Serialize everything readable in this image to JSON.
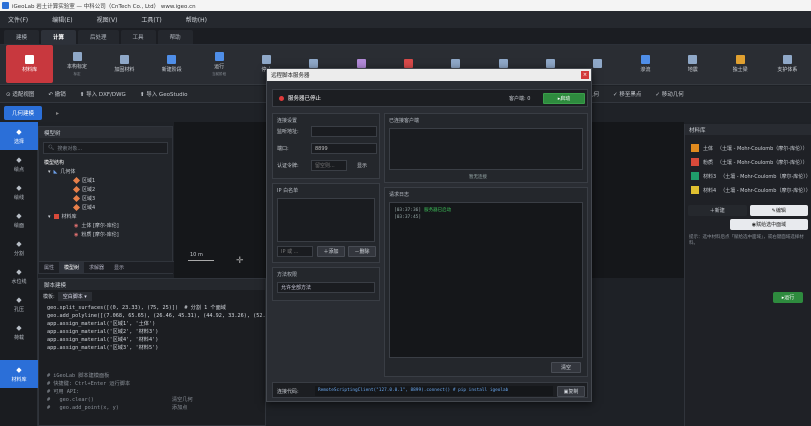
{
  "app": {
    "title": "iGeoLab 岩土计算实验室 — 中科公司（CnTech Co., Ltd） www.igeo.cn"
  },
  "menu": [
    "文件(F)",
    "编辑(E)",
    "视图(V)",
    "工具(T)",
    "帮助(H)"
  ],
  "tabs": [
    {
      "label": "建模",
      "active": false
    },
    {
      "label": "计算",
      "active": true
    },
    {
      "label": "后处理",
      "active": false
    },
    {
      "label": "工具",
      "active": false
    },
    {
      "label": "帮助",
      "active": false
    }
  ],
  "ribbon": [
    {
      "label": "材料库",
      "sub": "",
      "icon": "material-icon",
      "color": "#ffffff",
      "active": true
    },
    {
      "label": "本构标定",
      "sub": "标定",
      "icon": "calibrate-icon",
      "color": "#8fa8c8",
      "active": false
    },
    {
      "label": "加固材料",
      "sub": "",
      "icon": "reinforce-icon",
      "color": "#8fa8c8",
      "active": false
    },
    {
      "label": "新建阶段",
      "sub": "",
      "icon": "stage-icon",
      "color": "#4f8ee8",
      "active": false
    },
    {
      "label": "运行",
      "sub": "当前阶段",
      "icon": "run-icon",
      "color": "#4f8ee8",
      "active": false
    },
    {
      "label": "停止",
      "sub": "",
      "icon": "stop-icon",
      "color": "#8fa8c8",
      "active": false
    },
    {
      "label": "",
      "sub": "",
      "icon": "clock-icon",
      "color": "#8fa8c8",
      "active": false
    },
    {
      "label": "",
      "sub": "",
      "icon": "gear-icon",
      "color": "#b28ad8",
      "active": false
    },
    {
      "label": "",
      "sub": "",
      "icon": "flag-icon",
      "color": "#d84a4a",
      "active": false
    },
    {
      "label": "",
      "sub": "",
      "icon": "report-icon",
      "color": "#8fa8c8",
      "active": false
    },
    {
      "label": "",
      "sub": "",
      "icon": "pointer-icon",
      "color": "#8fa8c8",
      "active": false
    },
    {
      "label": "",
      "sub": "",
      "icon": "chart-icon",
      "color": "#8fa8c8",
      "active": false
    },
    {
      "label": "",
      "sub": "",
      "icon": "trash-icon",
      "color": "#8fa8c8",
      "active": false
    },
    {
      "label": "渗流",
      "sub": "",
      "icon": "water-icon",
      "color": "#4f8ee8",
      "active": false
    },
    {
      "label": "地震",
      "sub": "",
      "icon": "quake-icon",
      "color": "#8fa8c8",
      "active": false
    },
    {
      "label": "独士梁",
      "sub": "",
      "icon": "beam-icon",
      "color": "#e0a030",
      "active": false
    },
    {
      "label": "支护体系",
      "sub": "",
      "icon": "support-icon",
      "color": "#8fa8c8",
      "active": false
    }
  ],
  "toolbar": {
    "fit": "适配视图",
    "undo": "撤销",
    "import_dxf": "导入 DXF/DWG",
    "import_geostudio": "导入 GeoStudio",
    "right_label": "几何",
    "move_point": "移至黑点",
    "move_geometry": "移动几何"
  },
  "subtool": {
    "geo_modeling": "几何建模"
  },
  "leftbar": [
    {
      "label": "选择",
      "icon": "select-icon",
      "active": true
    },
    {
      "label": "绘点",
      "icon": "point-icon",
      "active": false
    },
    {
      "label": "绘线",
      "icon": "line-icon",
      "active": false
    },
    {
      "label": "绘面",
      "icon": "face-icon",
      "active": false
    },
    {
      "label": "分割",
      "icon": "split-icon",
      "active": false
    },
    {
      "label": "水位线",
      "icon": "waterline-icon",
      "active": false
    },
    {
      "label": "孔压",
      "icon": "pore-icon",
      "active": false
    },
    {
      "label": "荷载",
      "icon": "load-icon",
      "active": false
    },
    {
      "label": "材料库",
      "icon": "material-icon",
      "active": true
    }
  ],
  "tree": {
    "title": "模型树",
    "search_placeholder": "搜索对象...",
    "section": "模型结构",
    "geometry": "几何体",
    "regions": [
      "区域1",
      "区域2",
      "区域3",
      "区域4"
    ],
    "material_lib": "材料库",
    "materials": [
      "土体 [摩尔-库伦]",
      "粉质 [摩尔-库伦]"
    ],
    "tabs": [
      {
        "label": "属性",
        "active": false
      },
      {
        "label": "模型树",
        "active": true
      },
      {
        "label": "求解器",
        "active": false
      },
      {
        "label": "显示",
        "active": false
      }
    ]
  },
  "scale": {
    "label": "10 m"
  },
  "script": {
    "title": "脚本建模",
    "mode_label": "模板:",
    "mode_value": "空白脚本",
    "code": [
      "geo.split_surfaces([(0, 23.33), (75, 25)])  # 分割 1 个面域",
      "geo.add_polyline([(7.068, 65.65), (26.46, 45.31), (44.92, 33.26), (52.07",
      "app.assign_material('区域1', '土体')",
      "app.assign_material('区域2', '材料3')",
      "app.assign_material('区域4', '材料4')",
      "app.assign_material('区域3', '材料5')"
    ],
    "comments": [
      "# iGeoLab 脚本建模面板",
      "# 快捷键: Ctrl+Enter 运行脚本",
      "# 可用 API:",
      "#   geo.clear()                         清空几何",
      "#   geo.add_point(x, y)                 添加点"
    ]
  },
  "right_panel": {
    "title": "材料库",
    "materials": [
      {
        "name": "土体",
        "model": "（土壤 - Mohr-Coulomb（摩尔-库伦））",
        "color": "#e08a1e"
      },
      {
        "name": "粉质",
        "model": "（土壤 - Mohr-Coulomb（摩尔-库伦））",
        "color": "#d84a3a"
      },
      {
        "name": "材料3",
        "model": "（土壤 - Mohr-Coulomb（摩尔-库伦））",
        "color": "#1f9d6b"
      },
      {
        "name": "材料4",
        "model": "（土壤 - Mohr-Coulomb（摩尔-库伦））",
        "color": "#e0c030"
      }
    ],
    "new_btn": "新建",
    "edit_btn": "编辑",
    "assign_btn": "赋给选中面域",
    "hint": "提示：选中材料后点「赋给选中面域」，或右键面域选择材料。",
    "run_btn": "运行"
  },
  "modal": {
    "title": "远程脚本服务器",
    "status": "服务器已停止",
    "client_label": "客户端: 0",
    "start_btn": "启动",
    "conn_title": "连接设置",
    "listen_label": "监听地址:",
    "listen_value": "",
    "port_label": "端口:",
    "port_value": "8899",
    "token_label": "认证令牌:",
    "token_value": "留空则...",
    "show_btn": "显示",
    "ip_title": "IP 白名单",
    "ip_placeholder": "IP 或 ...",
    "add_btn": "添加",
    "del_btn": "删除",
    "method_title": "方法权限",
    "method_value": "允许全部方法",
    "clients_title": "已连接客户端",
    "no_conn": "暂无连接",
    "log_title": "请求日志",
    "log": [
      {
        "time": "[03:37:36]",
        "msg": "服务器已启动",
        "color": "#3ec35a"
      },
      {
        "time": "[03:37:45]",
        "msg": "",
        "color": "#e04848"
      }
    ],
    "clear_btn": "清空",
    "conn_code_label": "连接代码:",
    "conn_code": "RemoteScriptingClient(\"127.0.0.1\", 8899).connect()  # pip install igeolab",
    "copy_btn": "复制"
  }
}
